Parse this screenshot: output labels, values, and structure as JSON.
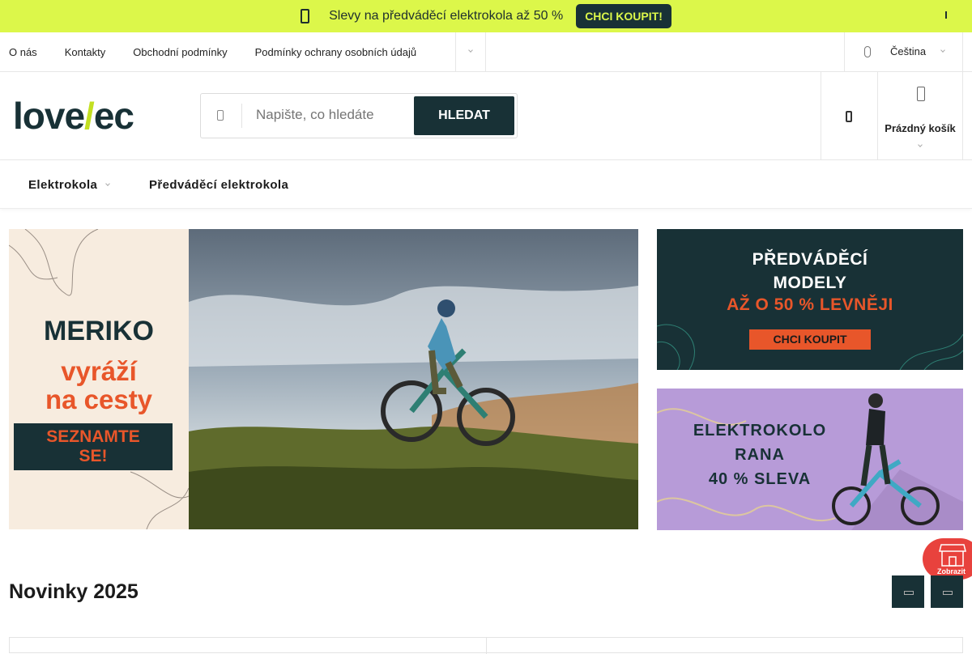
{
  "promo": {
    "text": "Slevy na předváděcí elektrokola až 50 %",
    "button": "CHCI KOUPIT!"
  },
  "topnav": {
    "links": [
      "O nás",
      "Kontakty",
      "Obchodní podmínky",
      "Podmínky ochrany osobních údajů"
    ],
    "language": "Čeština"
  },
  "header": {
    "logo": {
      "left": "love",
      "bolt": "/",
      "right": "ec"
    },
    "search": {
      "placeholder": "Napište, co hledáte",
      "button": "HLEDAT"
    },
    "cart": {
      "label": "Prázdný košík"
    }
  },
  "catnav": {
    "items": [
      "Elektrokola",
      "Předváděcí elektrokola"
    ]
  },
  "hero": {
    "title": "MERIKO",
    "sub1": "vyráží",
    "sub2": "na cesty",
    "cta1": "SEZNAMTE",
    "cta2": "SE!"
  },
  "side_banner_1": {
    "line1": "PŘEDVÁDĚCÍ",
    "line2": "MODELY",
    "line3": "AŽ O 50 % LEVNĚJI",
    "button": "CHCI KOUPIT"
  },
  "side_banner_2": {
    "line1": "ELEKTROKOLO",
    "line2": "RANA",
    "line3": "40 % SLEVA"
  },
  "store_fab": {
    "label": "Zobrazit"
  },
  "section": {
    "title": "Novinky 2025"
  },
  "colors": {
    "accent_lime": "#dcf74a",
    "brand_dark": "#183136",
    "orange": "#e8562a",
    "lilac": "#b79bd8",
    "fab_red": "#e8423d"
  }
}
